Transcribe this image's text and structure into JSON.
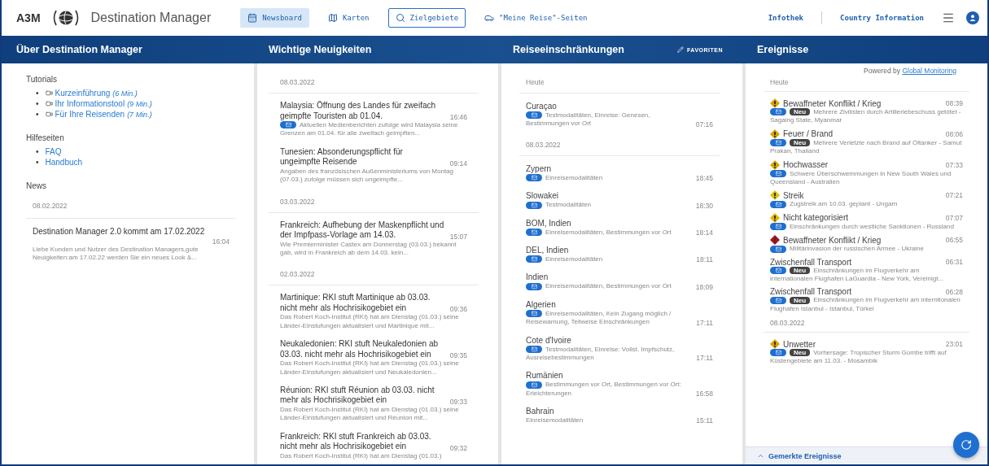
{
  "app": {
    "brand": "A3M",
    "title": "Destination Manager"
  },
  "nav": [
    {
      "label": "Newsboard",
      "selected": true,
      "focused": false
    },
    {
      "label": "Karten",
      "selected": false,
      "focused": false
    },
    {
      "label": "Zielgebiete",
      "selected": false,
      "focused": true
    },
    {
      "label": "\"Meine Reise\"-Seiten",
      "selected": false,
      "focused": false
    }
  ],
  "nav_right": [
    "Infothek",
    "Country Information"
  ],
  "about": {
    "title": "Über Destination Manager",
    "tutorials_heading": "Tutorials",
    "tutorials": [
      {
        "marker": "•",
        "label": "Kurzeinführung",
        "duration": "(6 Min.)"
      },
      {
        "marker": "•",
        "label": "Ihr Informationstool",
        "duration": "(9 Min.)"
      },
      {
        "marker": "•",
        "label": "Für Ihre Reisenden",
        "duration": "(7 Min.)"
      }
    ],
    "help_heading": "Hilfeseiten",
    "help_links": [
      {
        "marker": "•",
        "label": "FAQ"
      },
      {
        "marker": "•",
        "label": "Handbuch"
      }
    ],
    "news_heading": "News",
    "news_date": "08.02.2022",
    "news": [
      {
        "title": "Destination Manager 2.0 kommt am 17.02.2022",
        "time": "16:04",
        "summary": "Liebe Kunden und Nutzer des Destination Managers,gute Neuigkeiten:am 17.02.22 werden Sie ein neues Look &..."
      }
    ]
  },
  "headlines": {
    "title": "Wichtige Neuigkeiten",
    "groups": [
      {
        "date": "08.03.2022",
        "items": [
          {
            "title": "Malaysia: Öffnung des Landes für zweifach geimpfte Touristen ab 01.04.",
            "time": "16:46",
            "mail": true,
            "summary": "Aktuellen Medienberichten zufolge wird Malaysia seine Grenzen am 01.04. für alle zweifach geimpften..."
          },
          {
            "title": "Tunesien: Absonderungspflicht für ungeimpfte Reisende",
            "time": "09:14",
            "mail": false,
            "summary": "Angaben des französischen Außenministeriums von Montag (07.03.) zufolge müssen sich ungeimpfte..."
          }
        ]
      },
      {
        "date": "03.03.2022",
        "items": [
          {
            "title": "Frankreich: Aufhebung der Maskenpflicht und der Impfpass-Vorlage am 14.03.",
            "time": "15:07",
            "mail": false,
            "summary": "Wie Premierminister Castex am Donnerstag (03.03.) bekannt gab, wird in Frankreich ab dem 14.03. kein..."
          }
        ]
      },
      {
        "date": "02.03.2022",
        "items": [
          {
            "title": "Martinique: RKI stuft Martinique ab 03.03. nicht mehr als Hochrisikogebiet ein",
            "time": "09:36",
            "mail": false,
            "summary": "Das Robert Koch-Institut (RKI) hat am Dienstag (01.03.) seine Länder-Einstufungen aktualisiert und Martinique mit..."
          },
          {
            "title": "Neukaledonien: RKI stuft Neukaledonien ab 03.03. nicht mehr als Hochrisikogebiet ein",
            "time": "09:35",
            "mail": false,
            "summary": "Das Robert Koch-Institut (RKI) hat am Dienstag (01.03.) seine Länder-Einstufungen aktualisiert und Neukaledonien..."
          },
          {
            "title": "Réunion: RKI stuft Réunion ab 03.03. nicht mehr als Hochrisikogebiet ein",
            "time": "09:33",
            "mail": false,
            "summary": "Das Robert Koch-Institut (RKI) hat am Dienstag (01.03.) seine Länder-Einstufungen aktualisiert und Réunion mit..."
          },
          {
            "title": "Frankreich: RKI stuft Frankreich ab 03.03. nicht mehr als Hochrisikogebiet ein",
            "time": "09:32",
            "mail": false,
            "summary": "Das Robert Koch-Institut (RKI) hat am Dienstag (01.03.)"
          }
        ]
      }
    ]
  },
  "restrictions": {
    "title": "Reiseeinschränkungen",
    "favorites_label": "FAVORITEN",
    "groups": [
      {
        "date": "Heute",
        "items": [
          {
            "place": "Curaçao",
            "text": "Testmodalitäten, Einreise: Genesen, Bestimmungen vor Ort",
            "time": "07:16",
            "mail": true
          }
        ]
      },
      {
        "date": "08.03.2022",
        "items": [
          {
            "place": "Zypern",
            "text": "Einreisemodalitäten",
            "time": "18:45",
            "mail": true
          },
          {
            "place": "Slowakei",
            "text": "Testmodalitäten",
            "time": "18:30",
            "mail": true
          },
          {
            "place": "BOM, Indien",
            "text": "Einreisemodalitäten, Bestimmungen vor Ort",
            "time": "18:14",
            "mail": true
          },
          {
            "place": "DEL, Indien",
            "text": "Einreisemodalitäten",
            "time": "18:11",
            "mail": true
          },
          {
            "place": "Indien",
            "text": "Einreisemodalitäten, Bestimmungen vor Ort",
            "time": "18:09",
            "mail": true
          },
          {
            "place": "Algerien",
            "text": "Einreisemodalitäten, Kein Zugang möglich / Reisewarnung, Teilweise Einschränkungen",
            "time": "17:11",
            "mail": true
          },
          {
            "place": "Cote d'Ivoire",
            "text": "Testmodalitäten, Einreise: Vollst. Impfschutz, Ausreisebestimmungen",
            "time": "17:11",
            "mail": true
          },
          {
            "place": "Rumänien",
            "text": "Bestimmungen vor Ort, Bestimmungen vor Ort: Erleichterungen",
            "time": "16:58",
            "mail": true
          },
          {
            "place": "Bahrain",
            "text": "Einreisemodalitäten",
            "time": "15:11",
            "mail": false
          }
        ]
      }
    ]
  },
  "events": {
    "title": "Ereignisse",
    "powered_prefix": "Powered by",
    "powered_link": "Global Monitoring",
    "groups": [
      {
        "date": "Heute",
        "items": [
          {
            "category": "Bewaffneter Konflikt / Krieg",
            "time": "08:39",
            "mail": true,
            "badge": "Neu",
            "color": "#d9a400",
            "text": "Mehrere Zivilisten durch Artilleriebeschuss getötet - Sagaing State, Myanmar"
          },
          {
            "category": "Feuer / Brand",
            "time": "08:06",
            "mail": true,
            "badge": "Neu",
            "color": "#d9a400",
            "text": "Mehrere Verletzte nach Brand auf Öltanker - Samut Prakan, Thailand"
          },
          {
            "category": "Hochwasser",
            "time": "07:33",
            "mail": true,
            "color": "#d9a400",
            "text": "Schwere Überschwemmungen in New South Wales und Queensland - Australien"
          },
          {
            "category": "Streik",
            "time": "07:21",
            "mail": true,
            "color": "#d9c400",
            "text": "Zugstreik am 10.03. geplant - Ungarn"
          },
          {
            "category": "Nicht kategorisiert",
            "time": "07:07",
            "mail": true,
            "color": "#e8b400",
            "text": "Einschränkungen durch westliche Sanktionen - Russland"
          },
          {
            "category": "Bewaffneter Konflikt / Krieg",
            "time": "06:55",
            "mail": true,
            "color": "#b0101a",
            "text": "Militärinvasion der russischen Armee - Ukraine"
          },
          {
            "category": "Zwischenfall Transport",
            "time": "06:31",
            "mail": true,
            "badge": "Neu",
            "text": "Einschränkungen im Flugverkehr am internationalen Flughafen LaGuardia - New York, Vereinigt..."
          },
          {
            "category": "Zwischenfall Transport",
            "time": "06:28",
            "mail": true,
            "badge": "Neu",
            "text": "Einschränkungen im Flugverkehr am interntionalen Flughafen Istanbul - Istanbul, Türkei"
          }
        ]
      },
      {
        "date": "08.03.2022",
        "items": [
          {
            "category": "Unwetter",
            "time": "23:01",
            "mail": true,
            "badge": "Neu",
            "color": "#d9a400",
            "text": "Vorhersage: Tropischer Sturm Gombe trifft auf Küstengebiete am 11.03. - Mosambik"
          }
        ]
      }
    ],
    "footer": "Gemerkte Ereignisse"
  }
}
